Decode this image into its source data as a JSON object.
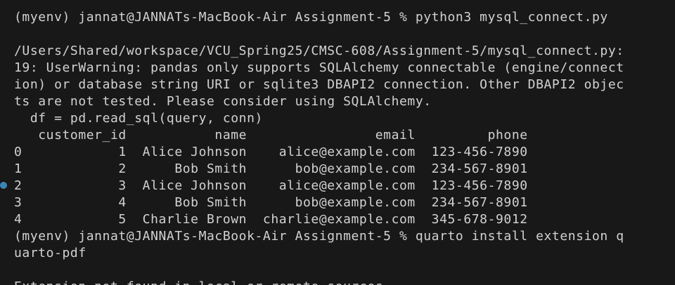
{
  "terminal": {
    "lines": [
      "(myenv) jannat@JANNATs-MacBook-Air Assignment-5 % python3 mysql_connect.py",
      "",
      "/Users/Shared/workspace/VCU_Spring25/CMSC-608/Assignment-5/mysql_connect.py:",
      "19: UserWarning: pandas only supports SQLAlchemy connectable (engine/connect",
      "ion) or database string URI or sqlite3 DBAPI2 connection. Other DBAPI2 objec",
      "ts are not tested. Please consider using SQLAlchemy.",
      "  df = pd.read_sql(query, conn)",
      "   customer_id           name                email         phone",
      "0            1  Alice Johnson    alice@example.com  123-456-7890",
      "1            2      Bob Smith      bob@example.com  234-567-8901",
      "2            3  Alice Johnson    alice@example.com  123-456-7890",
      "3            4      Bob Smith      bob@example.com  234-567-8901",
      "4            5  Charlie Brown  charlie@example.com  345-678-9012",
      "(myenv) jannat@JANNATs-MacBook-Air Assignment-5 % quarto install extension q",
      "uarto-pdf",
      "",
      "Extension not found in local or remote sources"
    ],
    "marker_color": "#3b84b8",
    "text_color": "#d2d2d2",
    "background_color": "#181818"
  }
}
